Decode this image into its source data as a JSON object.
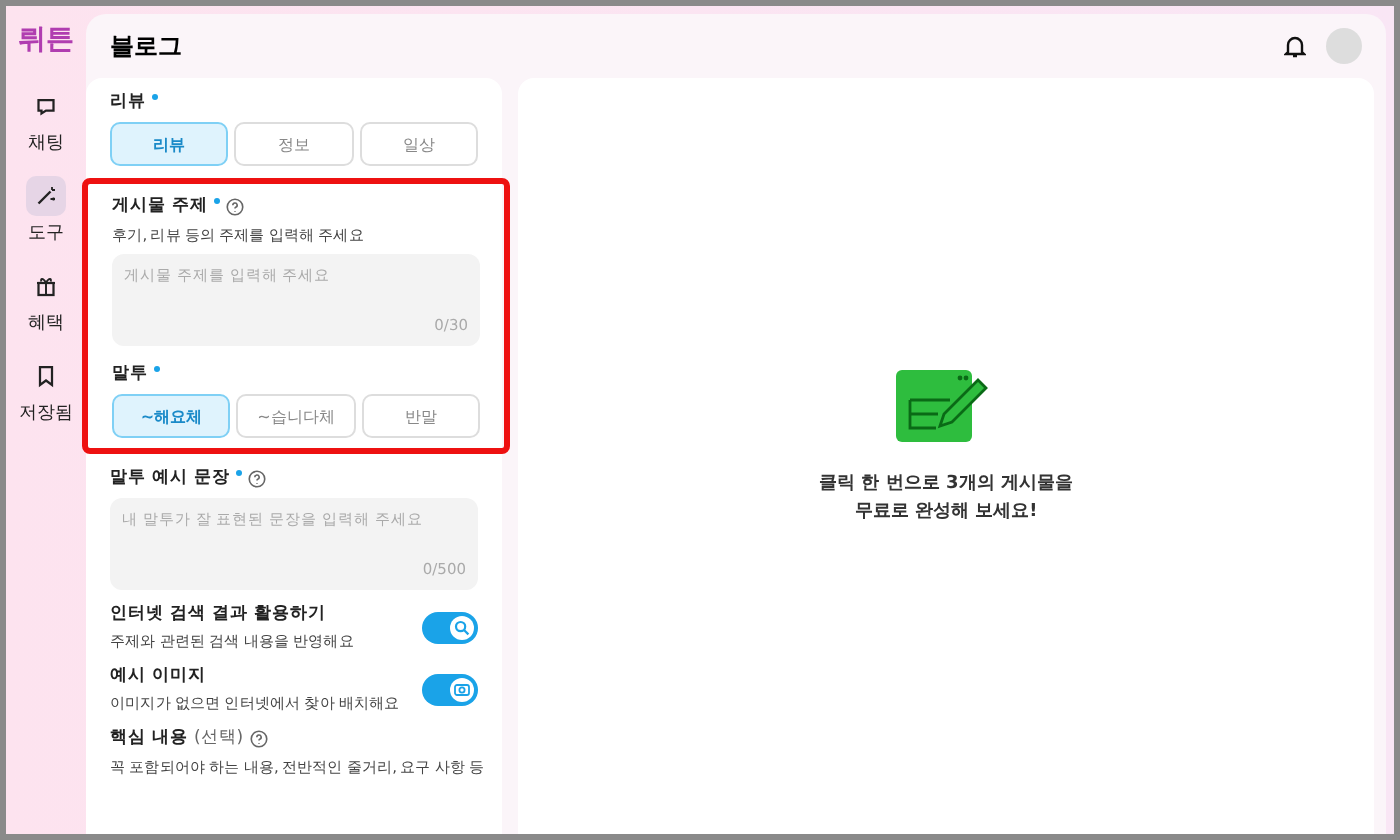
{
  "sidebar": {
    "logo": "뤼튼",
    "items": [
      {
        "label": "채팅",
        "selected": false
      },
      {
        "label": "도구",
        "selected": true
      },
      {
        "label": "혜택",
        "selected": false
      },
      {
        "label": "저장됨",
        "selected": false
      }
    ]
  },
  "header": {
    "title": "블로그"
  },
  "form": {
    "category": {
      "label": "리뷰",
      "required": true,
      "options": [
        {
          "label": "리뷰",
          "selected": true
        },
        {
          "label": "정보",
          "selected": false
        },
        {
          "label": "일상",
          "selected": false
        }
      ]
    },
    "topic": {
      "label": "게시물 주제",
      "required": true,
      "hint": "후기, 리뷰 등의 주제를 입력해 주세요",
      "placeholder": "게시물 주제를 입력해 주세요",
      "counter": "0/30"
    },
    "tone": {
      "label": "말투",
      "required": true,
      "options": [
        {
          "label": "~해요체",
          "selected": true
        },
        {
          "label": "~습니다체",
          "selected": false
        },
        {
          "label": "반말",
          "selected": false
        }
      ]
    },
    "example": {
      "label": "말투 예시 문장",
      "required": true,
      "placeholder": "내 말투가 잘 표현된 문장을 입력해 주세요",
      "counter": "0/500"
    },
    "toggles": [
      {
        "label": "인터넷 검색 결과 활용하기",
        "hint": "주제와 관련된 검색 내용을 반영해요",
        "on": true
      },
      {
        "label": "예시 이미지",
        "hint": "이미지가 없으면 인터넷에서 찾아 배치해요",
        "on": true
      }
    ],
    "key_content": {
      "label": "핵심 내용",
      "optional": "(선택)",
      "hint": "꼭 포함되어야 하는 내용, 전반적인 줄거리, 요구 사항 등"
    }
  },
  "preview": {
    "message": "클릭 한 번으로 3개의 게시물을\n무료로 완성해 보세요!"
  }
}
